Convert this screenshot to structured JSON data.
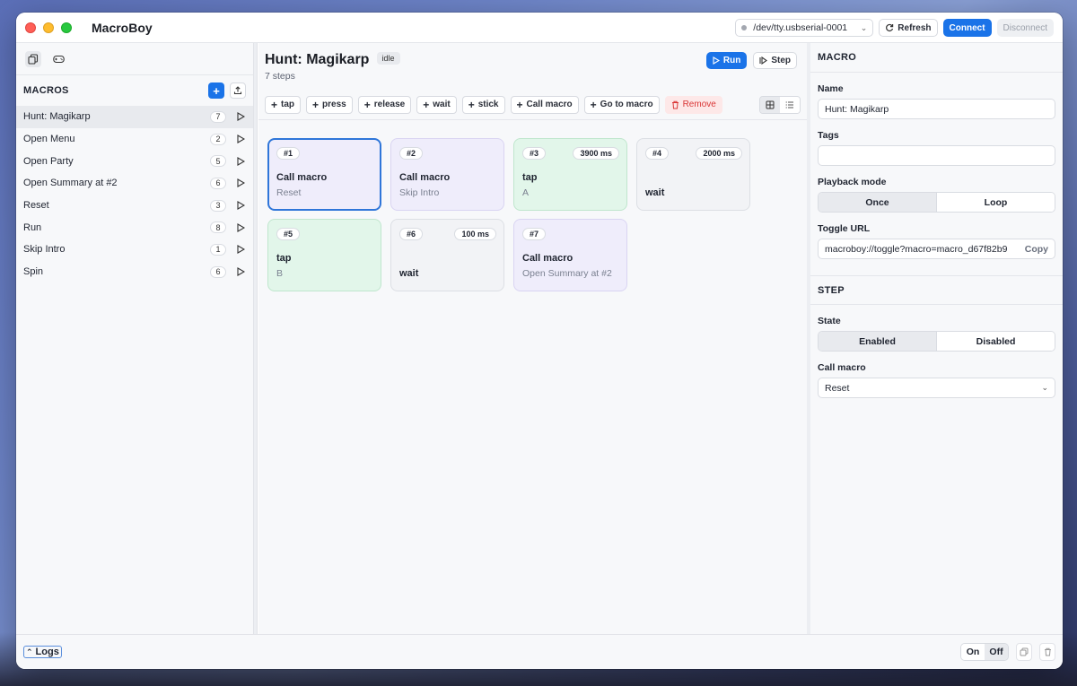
{
  "app": {
    "title": "MacroBoy"
  },
  "connection": {
    "port": "/dev/tty.usbserial-0001",
    "refresh_label": "Refresh",
    "connect_label": "Connect",
    "disconnect_label": "Disconnect"
  },
  "sidebar": {
    "heading": "MACROS",
    "items": [
      {
        "name": "Hunt: Magikarp",
        "count": "7"
      },
      {
        "name": "Open Menu",
        "count": "2"
      },
      {
        "name": "Open Party",
        "count": "5"
      },
      {
        "name": "Open Summary at #2",
        "count": "6"
      },
      {
        "name": "Reset",
        "count": "3"
      },
      {
        "name": "Run",
        "count": "8"
      },
      {
        "name": "Skip Intro",
        "count": "1"
      },
      {
        "name": "Spin",
        "count": "6"
      }
    ]
  },
  "editor": {
    "title": "Hunt: Magikarp",
    "status": "idle",
    "step_count": "7 steps",
    "run_label": "Run",
    "step_label": "Step",
    "tools": [
      "tap",
      "press",
      "release",
      "wait",
      "stick",
      "Call macro",
      "Go to macro"
    ],
    "remove_label": "Remove",
    "cards": [
      {
        "num": "#1",
        "duration": "",
        "kind": "Call macro",
        "arg": "Reset"
      },
      {
        "num": "#2",
        "duration": "",
        "kind": "Call macro",
        "arg": "Skip Intro"
      },
      {
        "num": "#3",
        "duration": "3900 ms",
        "kind": "tap",
        "arg": "A"
      },
      {
        "num": "#4",
        "duration": "2000 ms",
        "kind": "wait",
        "arg": ""
      },
      {
        "num": "#5",
        "duration": "",
        "kind": "tap",
        "arg": "B"
      },
      {
        "num": "#6",
        "duration": "100 ms",
        "kind": "wait",
        "arg": ""
      },
      {
        "num": "#7",
        "duration": "",
        "kind": "Call macro",
        "arg": "Open Summary at #2"
      }
    ]
  },
  "inspector": {
    "macro_heading": "MACRO",
    "name_label": "Name",
    "name_value": "Hunt: Magikarp",
    "tags_label": "Tags",
    "tags_value": "",
    "playback_label": "Playback mode",
    "playback_once": "Once",
    "playback_loop": "Loop",
    "url_label": "Toggle URL",
    "url_value": "macroboy://toggle?macro=macro_d67f82b9",
    "copy_label": "Copy",
    "step_heading": "STEP",
    "state_label": "State",
    "state_enabled": "Enabled",
    "state_disabled": "Disabled",
    "call_label": "Call macro",
    "call_value": "Reset"
  },
  "bottom": {
    "logs_label": "Logs",
    "on_label": "On",
    "off_label": "Off"
  },
  "colors": {
    "accent": "#1a73e8",
    "danger": "#d93636",
    "call_card": "#efedfb",
    "tap_card": "#e2f6ea",
    "wait_card": "#f2f3f6"
  }
}
